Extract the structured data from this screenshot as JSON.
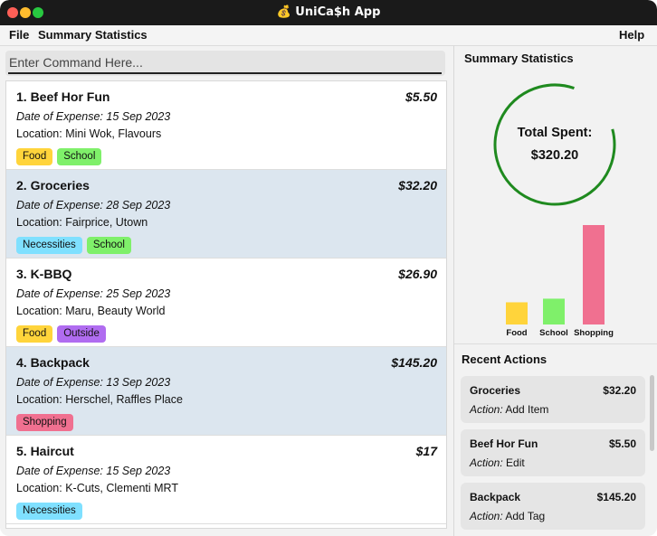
{
  "window": {
    "title": "💰 UniCa$h App"
  },
  "menu": {
    "file": "File",
    "summary": "Summary Statistics",
    "help": "Help"
  },
  "command": {
    "placeholder": "Enter Command Here..."
  },
  "expenses": [
    {
      "index_name": "1. Beef Hor Fun",
      "amount": "$5.50",
      "date": "Date of Expense: 15 Sep 2023",
      "location": "Location: Mini Wok, Flavours",
      "tags": [
        {
          "label": "Food",
          "color": "#ffd43b"
        },
        {
          "label": "School",
          "color": "#7ff06a"
        }
      ]
    },
    {
      "index_name": "2. Groceries",
      "amount": "$32.20",
      "date": "Date of Expense: 28 Sep 2023",
      "location": "Location: Fairprice, Utown",
      "tags": [
        {
          "label": "Necessities",
          "color": "#7fe0ff"
        },
        {
          "label": "School",
          "color": "#7ff06a"
        }
      ]
    },
    {
      "index_name": "3. K-BBQ",
      "amount": "$26.90",
      "date": "Date of Expense: 25 Sep 2023",
      "location": "Location: Maru, Beauty World",
      "tags": [
        {
          "label": "Food",
          "color": "#ffd43b"
        },
        {
          "label": "Outside",
          "color": "#b06cf0"
        }
      ]
    },
    {
      "index_name": "4. Backpack",
      "amount": "$145.20",
      "date": "Date of Expense: 13 Sep 2023",
      "location": "Location: Herschel, Raffles Place",
      "tags": [
        {
          "label": "Shopping",
          "color": "#f07090"
        }
      ]
    },
    {
      "index_name": "5. Haircut",
      "amount": "$17",
      "date": "Date of Expense: 15 Sep 2023",
      "location": "Location: K-Cuts, Clementi MRT",
      "tags": [
        {
          "label": "Necessities",
          "color": "#7fe0ff"
        }
      ]
    }
  ],
  "summary": {
    "title": "Summary Statistics",
    "total_label": "Total Spent:",
    "total_value": "$320.20",
    "ring_color": "#1f8a1f"
  },
  "chart_data": {
    "type": "bar",
    "categories": [
      "Food",
      "School",
      "Shopping"
    ],
    "values": [
      32.4,
      37.7,
      145.2
    ],
    "colors": [
      "#ffd43b",
      "#7ff06a",
      "#f07090"
    ]
  },
  "recent": {
    "title": "Recent Actions",
    "action_prefix": "Action:",
    "items": [
      {
        "name": "Groceries",
        "amount": "$32.20",
        "action": "Add Item"
      },
      {
        "name": "Beef Hor Fun",
        "amount": "$5.50",
        "action": "Edit"
      },
      {
        "name": "Backpack",
        "amount": "$145.20",
        "action": "Add Tag"
      }
    ]
  }
}
